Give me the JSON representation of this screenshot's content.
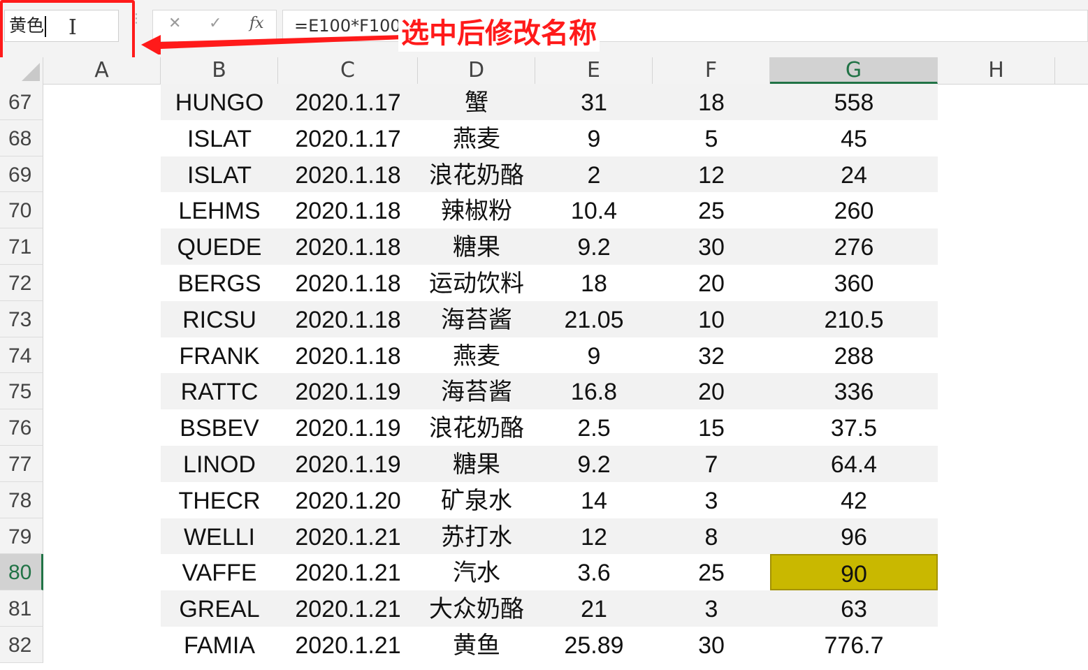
{
  "name_box": {
    "value": "黄色"
  },
  "formula_bar": {
    "cancel_icon": "✕",
    "enter_icon": "✓",
    "insert_function_label": "fx",
    "formula": "=E100*F100"
  },
  "annotation": {
    "text": "选中后修改名称",
    "color": "#ff1a1a"
  },
  "columns": [
    "A",
    "B",
    "C",
    "D",
    "E",
    "F",
    "G",
    "H"
  ],
  "selected_column": "G",
  "selected_row": "80",
  "rows": [
    {
      "num": "67",
      "B": "HUNGO",
      "C": "2020.1.17",
      "D": "蟹",
      "E": "31",
      "F": "18",
      "G": "558"
    },
    {
      "num": "68",
      "B": "ISLAT",
      "C": "2020.1.17",
      "D": "燕麦",
      "E": "9",
      "F": "5",
      "G": "45"
    },
    {
      "num": "69",
      "B": "ISLAT",
      "C": "2020.1.18",
      "D": "浪花奶酪",
      "E": "2",
      "F": "12",
      "G": "24"
    },
    {
      "num": "70",
      "B": "LEHMS",
      "C": "2020.1.18",
      "D": "辣椒粉",
      "E": "10.4",
      "F": "25",
      "G": "260"
    },
    {
      "num": "71",
      "B": "QUEDE",
      "C": "2020.1.18",
      "D": "糖果",
      "E": "9.2",
      "F": "30",
      "G": "276"
    },
    {
      "num": "72",
      "B": "BERGS",
      "C": "2020.1.18",
      "D": "运动饮料",
      "E": "18",
      "F": "20",
      "G": "360"
    },
    {
      "num": "73",
      "B": "RICSU",
      "C": "2020.1.18",
      "D": "海苔酱",
      "E": "21.05",
      "F": "10",
      "G": "210.5"
    },
    {
      "num": "74",
      "B": "FRANK",
      "C": "2020.1.18",
      "D": "燕麦",
      "E": "9",
      "F": "32",
      "G": "288"
    },
    {
      "num": "75",
      "B": "RATTC",
      "C": "2020.1.19",
      "D": "海苔酱",
      "E": "16.8",
      "F": "20",
      "G": "336"
    },
    {
      "num": "76",
      "B": "BSBEV",
      "C": "2020.1.19",
      "D": "浪花奶酪",
      "E": "2.5",
      "F": "15",
      "G": "37.5"
    },
    {
      "num": "77",
      "B": "LINOD",
      "C": "2020.1.19",
      "D": "糖果",
      "E": "9.2",
      "F": "7",
      "G": "64.4"
    },
    {
      "num": "78",
      "B": "THECR",
      "C": "2020.1.20",
      "D": "矿泉水",
      "E": "14",
      "F": "3",
      "G": "42"
    },
    {
      "num": "79",
      "B": "WELLI",
      "C": "2020.1.21",
      "D": "苏打水",
      "E": "12",
      "F": "8",
      "G": "96"
    },
    {
      "num": "80",
      "B": "VAFFE",
      "C": "2020.1.21",
      "D": "汽水",
      "E": "3.6",
      "F": "25",
      "G": "90"
    },
    {
      "num": "81",
      "B": "GREAL",
      "C": "2020.1.21",
      "D": "大众奶酪",
      "E": "21",
      "F": "3",
      "G": "63"
    },
    {
      "num": "82",
      "B": "FAMIA",
      "C": "2020.1.21",
      "D": "黄鱼",
      "E": "25.89",
      "F": "30",
      "G": "776.7"
    }
  ],
  "highlight_color": "#c9b800"
}
